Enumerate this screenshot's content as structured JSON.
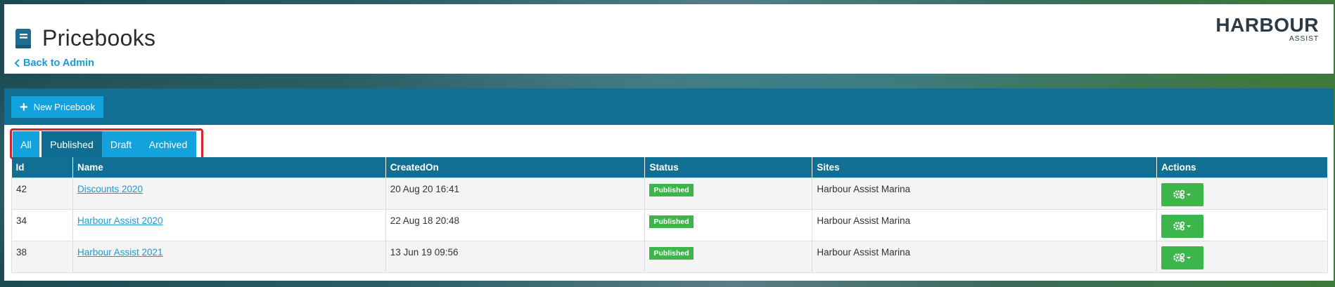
{
  "header": {
    "title": "Pricebooks",
    "back_link": "Back to Admin",
    "logo_main": "HARBOUR",
    "logo_sub": "ASSIST"
  },
  "toolbar": {
    "new_button": "New Pricebook"
  },
  "filters": [
    {
      "label": "All",
      "state": "active"
    },
    {
      "label": "Published",
      "state": "selected"
    },
    {
      "label": "Draft",
      "state": "default"
    },
    {
      "label": "Archived",
      "state": "default"
    }
  ],
  "table": {
    "columns": [
      "Id",
      "Name",
      "CreatedOn",
      "Status",
      "Sites",
      "Actions"
    ],
    "rows": [
      {
        "id": "42",
        "name": "Discounts 2020",
        "created": "20 Aug 20 16:41",
        "status": "Published",
        "sites": "Harbour Assist Marina"
      },
      {
        "id": "34",
        "name": "Harbour Assist 2020",
        "created": "22 Aug 18 20:48",
        "status": "Published",
        "sites": "Harbour Assist Marina"
      },
      {
        "id": "38",
        "name": "Harbour Assist 2021",
        "created": "13 Jun 19 09:56",
        "status": "Published",
        "sites": "Harbour Assist Marina"
      }
    ]
  },
  "colors": {
    "brand": "#116f93",
    "accent": "#13a3dc",
    "success": "#3cb54a",
    "highlight": "#d9232d"
  },
  "icons": {
    "title": "book-icon",
    "back": "chevron-left-icon",
    "new": "plus-icon",
    "actions": "gears-icon"
  }
}
